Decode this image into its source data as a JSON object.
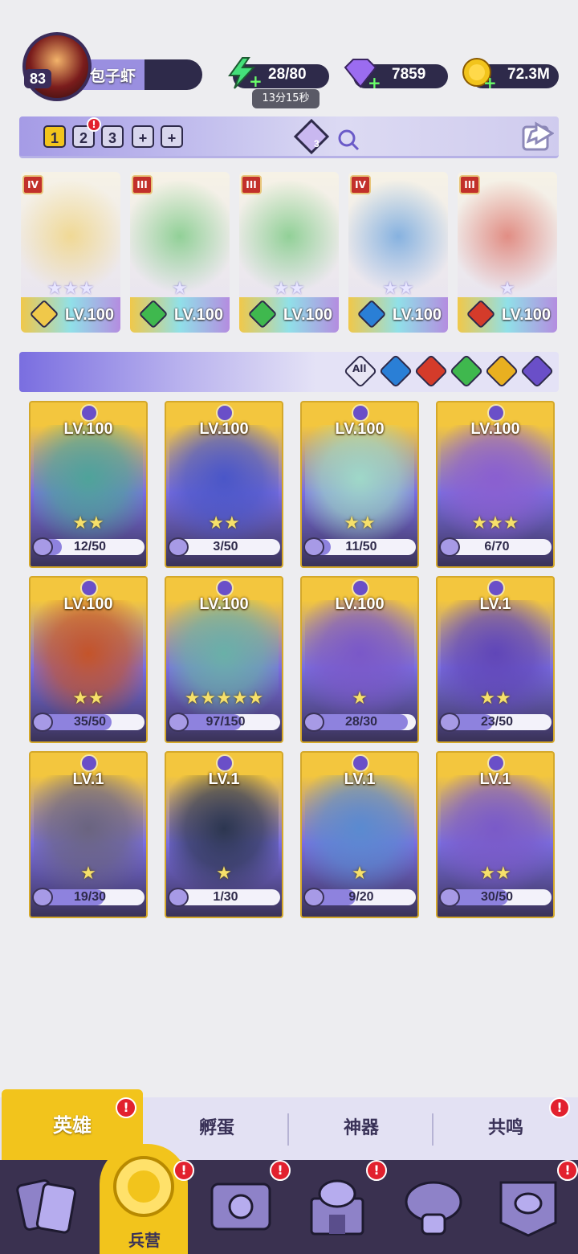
{
  "profile": {
    "level": "83",
    "name": "包子虾"
  },
  "resources": {
    "energy": "28/80",
    "energy_timer": "13分15秒",
    "gems": "7859",
    "gold": "72.3M"
  },
  "team": {
    "slots": [
      "1",
      "2",
      "3"
    ],
    "add_slots": [
      "+",
      "+"
    ],
    "crystal_count": "3",
    "members": [
      {
        "rank": "IV",
        "level": "LV.100",
        "stars": "★★★",
        "element": "light",
        "color": "#f0c84a"
      },
      {
        "rank": "III",
        "level": "LV.100",
        "stars": "★",
        "element": "nature",
        "color": "#3fb84e"
      },
      {
        "rank": "III",
        "level": "LV.100",
        "stars": "★★",
        "element": "nature",
        "color": "#3fb84e"
      },
      {
        "rank": "IV",
        "level": "LV.100",
        "stars": "★★",
        "element": "water",
        "color": "#2a7fd6"
      },
      {
        "rank": "III",
        "level": "LV.100",
        "stars": "★",
        "element": "fire",
        "color": "#d43b2a"
      }
    ]
  },
  "filters": {
    "all_label": "All",
    "items": [
      {
        "name": "water",
        "color": "#2a7fd6"
      },
      {
        "name": "fire",
        "color": "#d43b2a"
      },
      {
        "name": "nature",
        "color": "#3fb84e"
      },
      {
        "name": "light",
        "color": "#e9b020"
      },
      {
        "name": "dark",
        "color": "#6a4fc8"
      }
    ]
  },
  "heroes": [
    {
      "level": "LV.100",
      "stars": "★★",
      "progress": "12/50",
      "fill": 0.24,
      "art": "#4fa39a"
    },
    {
      "level": "LV.100",
      "stars": "★★",
      "progress": "3/50",
      "fill": 0.06,
      "art": "#4a56c8"
    },
    {
      "level": "LV.100",
      "stars": "★★",
      "progress": "11/50",
      "fill": 0.22,
      "art": "#9fd8c8"
    },
    {
      "level": "LV.100",
      "stars": "★★★",
      "progress": "6/70",
      "fill": 0.09,
      "art": "#8a5fd0"
    },
    {
      "level": "LV.100",
      "stars": "★★",
      "progress": "35/50",
      "fill": 0.7,
      "art": "#c4542a"
    },
    {
      "level": "LV.100",
      "stars": "★★★★★",
      "progress": "97/150",
      "fill": 0.65,
      "art": "#6ab0a8"
    },
    {
      "level": "LV.100",
      "stars": "★",
      "progress": "28/30",
      "fill": 0.93,
      "art": "#7a58c8"
    },
    {
      "level": "LV.1",
      "stars": "★★",
      "progress": "23/50",
      "fill": 0.46,
      "art": "#6046b8"
    },
    {
      "level": "LV.1",
      "stars": "★",
      "progress": "19/30",
      "fill": 0.63,
      "art": "#6a6480"
    },
    {
      "level": "LV.1",
      "stars": "★",
      "progress": "1/30",
      "fill": 0.03,
      "art": "#2c3650"
    },
    {
      "level": "LV.1",
      "stars": "★",
      "progress": "9/20",
      "fill": 0.45,
      "art": "#5a8ad0"
    },
    {
      "level": "LV.1",
      "stars": "★★",
      "progress": "30/50",
      "fill": 0.6,
      "art": "#7a5ac8"
    }
  ],
  "tabs": [
    "英雄",
    "孵蛋",
    "神器",
    "共鸣"
  ],
  "nav": {
    "active_label": "兵营"
  },
  "alerts": "!"
}
